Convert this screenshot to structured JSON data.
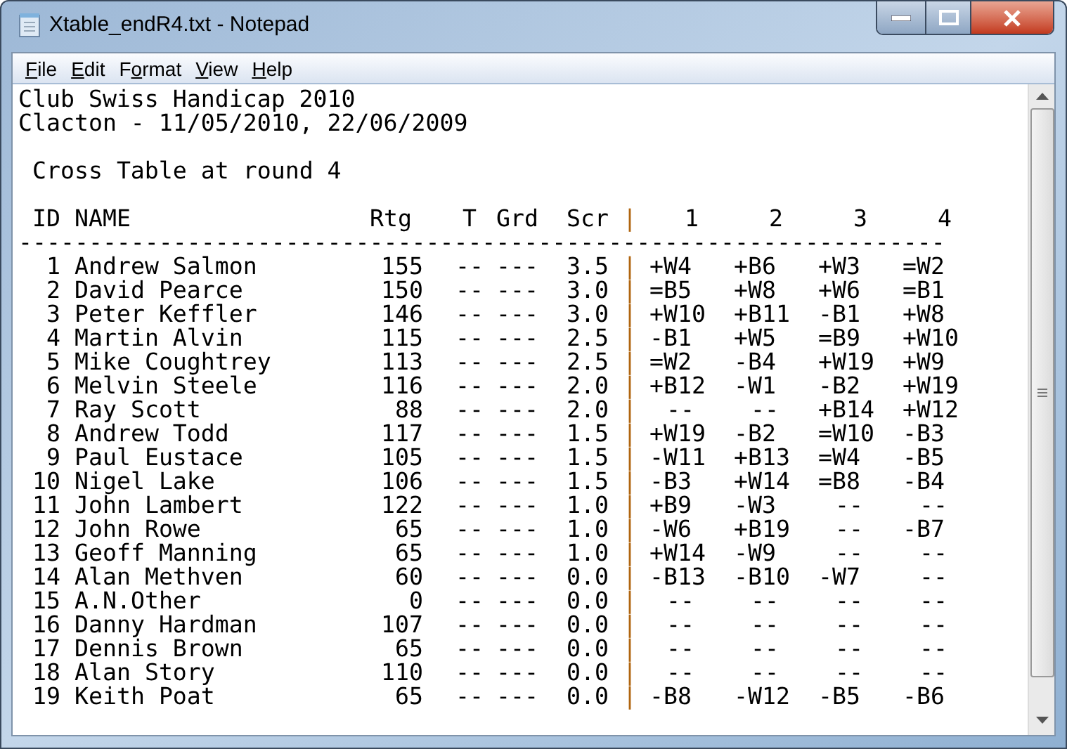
{
  "window": {
    "title": "Xtable_endR4.txt - Notepad"
  },
  "menu": [
    {
      "label_parts": [
        {
          "text": "F",
          "underlined": true
        },
        {
          "text": "ile",
          "underlined": false
        }
      ]
    },
    {
      "label_parts": [
        {
          "text": "E",
          "underlined": true
        },
        {
          "text": "dit",
          "underlined": false
        }
      ]
    },
    {
      "label_parts": [
        {
          "text": "F",
          "underlined": false
        },
        {
          "text": "o",
          "underlined": true
        },
        {
          "text": "rmat",
          "underlined": false
        }
      ]
    },
    {
      "label_parts": [
        {
          "text": "V",
          "underlined": true
        },
        {
          "text": "iew",
          "underlined": false
        }
      ]
    },
    {
      "label_parts": [
        {
          "text": "H",
          "underlined": true
        },
        {
          "text": "elp",
          "underlined": false
        }
      ]
    }
  ],
  "document": {
    "lines": [
      "Club Swiss Handicap 2010",
      "Clacton - 11/05/2010, 22/06/2009"
    ],
    "subtitle": "Cross Table at round 4",
    "header": {
      "id": "ID",
      "name": "NAME",
      "rtg": "Rtg",
      "t": "T",
      "grd": "Grd",
      "scr": "Scr",
      "separator": "|",
      "rounds": [
        "1",
        "2",
        "3",
        "4"
      ]
    },
    "rule": "------------------------------------------------------------------",
    "rows": [
      {
        "id": "1",
        "name": "Andrew Salmon",
        "rtg": "155",
        "t": "--",
        "grd": "---",
        "scr": "3.5",
        "separator": "|",
        "results": [
          "+W4",
          "+B6",
          "+W3",
          "=W2"
        ]
      },
      {
        "id": "2",
        "name": "David Pearce",
        "rtg": "150",
        "t": "--",
        "grd": "---",
        "scr": "3.0",
        "separator": "|",
        "results": [
          "=B5",
          "+W8",
          "+W6",
          "=B1"
        ]
      },
      {
        "id": "3",
        "name": "Peter Keffler",
        "rtg": "146",
        "t": "--",
        "grd": "---",
        "scr": "3.0",
        "separator": "|",
        "results": [
          "+W10",
          "+B11",
          "-B1",
          "+W8"
        ]
      },
      {
        "id": "4",
        "name": "Martin Alvin",
        "rtg": "115",
        "t": "--",
        "grd": "---",
        "scr": "2.5",
        "separator": "|",
        "results": [
          "-B1",
          "+W5",
          "=B9",
          "+W10"
        ]
      },
      {
        "id": "5",
        "name": "Mike Coughtrey",
        "rtg": "113",
        "t": "--",
        "grd": "---",
        "scr": "2.5",
        "separator": "|",
        "results": [
          "=W2",
          "-B4",
          "+W19",
          "+W9"
        ]
      },
      {
        "id": "6",
        "name": "Melvin Steele",
        "rtg": "116",
        "t": "--",
        "grd": "---",
        "scr": "2.0",
        "separator": "|",
        "results": [
          "+B12",
          "-W1",
          "-B2",
          "+W19"
        ]
      },
      {
        "id": "7",
        "name": "Ray Scott",
        "rtg": "88",
        "t": "--",
        "grd": "---",
        "scr": "2.0",
        "separator": "|",
        "results": [
          "--",
          "--",
          "+B14",
          "+W12"
        ]
      },
      {
        "id": "8",
        "name": "Andrew Todd",
        "rtg": "117",
        "t": "--",
        "grd": "---",
        "scr": "1.5",
        "separator": "|",
        "results": [
          "+W19",
          "-B2",
          "=W10",
          "-B3"
        ]
      },
      {
        "id": "9",
        "name": "Paul Eustace",
        "rtg": "105",
        "t": "--",
        "grd": "---",
        "scr": "1.5",
        "separator": "|",
        "results": [
          "-W11",
          "+B13",
          "=W4",
          "-B5"
        ]
      },
      {
        "id": "10",
        "name": "Nigel Lake",
        "rtg": "106",
        "t": "--",
        "grd": "---",
        "scr": "1.5",
        "separator": "|",
        "results": [
          "-B3",
          "+W14",
          "=B8",
          "-B4"
        ]
      },
      {
        "id": "11",
        "name": "John Lambert",
        "rtg": "122",
        "t": "--",
        "grd": "---",
        "scr": "1.0",
        "separator": "|",
        "results": [
          "+B9",
          "-W3",
          "--",
          "--"
        ]
      },
      {
        "id": "12",
        "name": "John Rowe",
        "rtg": "65",
        "t": "--",
        "grd": "---",
        "scr": "1.0",
        "separator": "|",
        "results": [
          "-W6",
          "+B19",
          "--",
          "-B7"
        ]
      },
      {
        "id": "13",
        "name": "Geoff Manning",
        "rtg": "65",
        "t": "--",
        "grd": "---",
        "scr": "1.0",
        "separator": "|",
        "results": [
          "+W14",
          "-W9",
          "--",
          "--"
        ]
      },
      {
        "id": "14",
        "name": "Alan Methven",
        "rtg": "60",
        "t": "--",
        "grd": "---",
        "scr": "0.0",
        "separator": "|",
        "results": [
          "-B13",
          "-B10",
          "-W7",
          "--"
        ]
      },
      {
        "id": "15",
        "name": "A.N.Other",
        "rtg": "0",
        "t": "--",
        "grd": "---",
        "scr": "0.0",
        "separator": "|",
        "results": [
          "--",
          "--",
          "--",
          "--"
        ]
      },
      {
        "id": "16",
        "name": "Danny Hardman",
        "rtg": "107",
        "t": "--",
        "grd": "---",
        "scr": "0.0",
        "separator": "|",
        "results": [
          "--",
          "--",
          "--",
          "--"
        ]
      },
      {
        "id": "17",
        "name": "Dennis Brown",
        "rtg": "65",
        "t": "--",
        "grd": "---",
        "scr": "0.0",
        "separator": "|",
        "results": [
          "--",
          "--",
          "--",
          "--"
        ]
      },
      {
        "id": "18",
        "name": "Alan Story",
        "rtg": "110",
        "t": "--",
        "grd": "---",
        "scr": "0.0",
        "separator": "|",
        "results": [
          "--",
          "--",
          "--",
          "--"
        ]
      },
      {
        "id": "19",
        "name": "Keith Poat",
        "rtg": "65",
        "t": "--",
        "grd": "---",
        "scr": "0.0",
        "separator": "|",
        "results": [
          "-B8",
          "-W12",
          "-B5",
          "-B6"
        ]
      }
    ]
  }
}
